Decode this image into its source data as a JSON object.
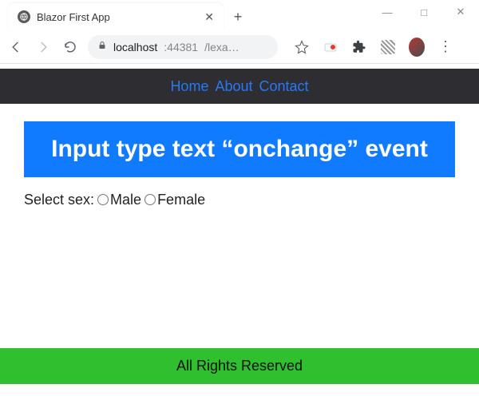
{
  "browser": {
    "tab_title": "Blazor First App",
    "url_host": "localhost",
    "url_port": ":44381",
    "url_path": "/lexa…",
    "window_minimize": "—",
    "window_maximize": "□",
    "window_close": "✕",
    "newtab": "+",
    "tab_close": "✕"
  },
  "nav": {
    "home": "Home",
    "about": "About",
    "contact": "Contact"
  },
  "content": {
    "heading": "Input type text “onchange” event",
    "select_label": "Select sex:",
    "option_male": "Male",
    "option_female": "Female"
  },
  "footer": {
    "text": "All Rights Reserved"
  }
}
